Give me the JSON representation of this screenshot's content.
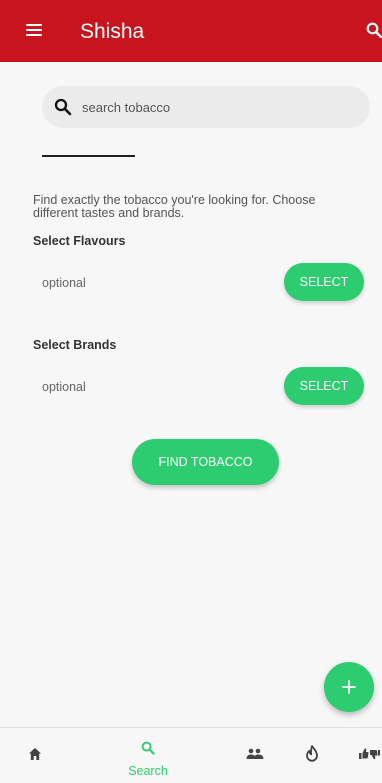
{
  "appbar": {
    "title": "Shisha",
    "menu_icon": "hamburger-menu-icon",
    "search_icon": "search-icon",
    "background_color": "#c8141d"
  },
  "search": {
    "placeholder": "search tobacco",
    "value": ""
  },
  "description": "Find exactly the tobacco you're looking for. Choose different tastes and brands.",
  "flavours": {
    "label": "Select Flavours",
    "value": "optional",
    "button_label": "SELECT"
  },
  "brands": {
    "label": "Select Brands",
    "value": "optional",
    "button_label": "SELECT"
  },
  "find_button_label": "FIND TOBACCO",
  "fab": {
    "icon": "plus-icon"
  },
  "bottom_nav": {
    "items": [
      {
        "icon": "home-icon",
        "label": ""
      },
      {
        "icon": "search-icon",
        "label": "Search",
        "active": true
      },
      {
        "icon": "people-icon",
        "label": ""
      },
      {
        "icon": "flame-icon",
        "label": ""
      },
      {
        "icon": "thumbs-icon",
        "label": ""
      }
    ]
  },
  "colors": {
    "accent": "#2ecc71",
    "appbar": "#c8141d",
    "background": "#f7f7f7"
  }
}
